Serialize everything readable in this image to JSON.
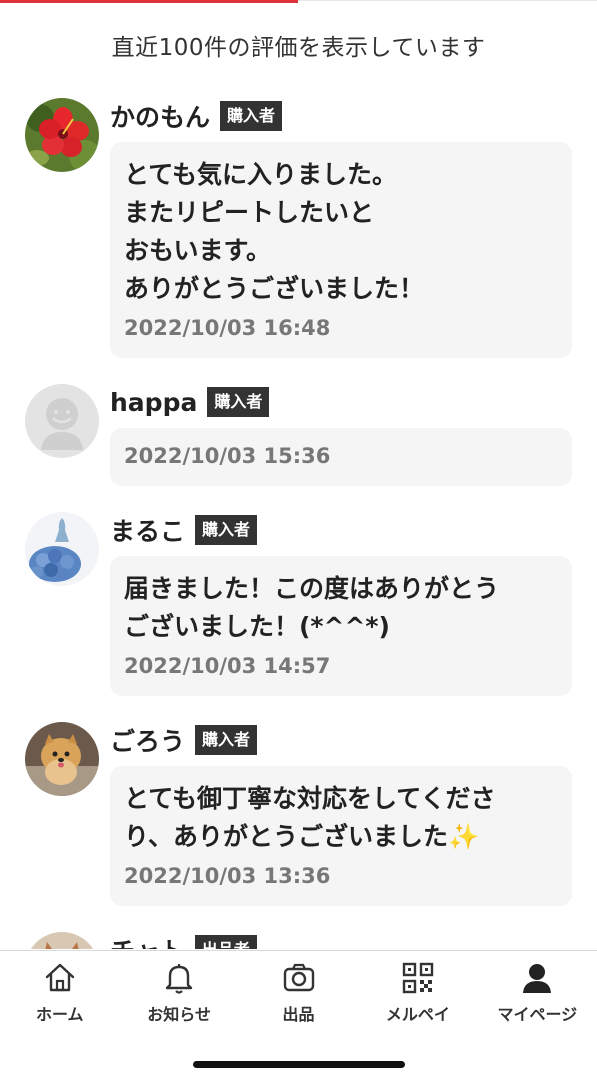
{
  "header": {
    "title": "直近100件の評価を表示しています"
  },
  "reviews": [
    {
      "name": "かのもん",
      "badge": "購入者",
      "comment": "とても気に入りました。\nまたリピートしたいと\nおもいます。\nありがとうございました！",
      "date": "2022/10/03 16:48",
      "avatar_icon": "hibiscus-photo-avatar"
    },
    {
      "name": "happa",
      "badge": "購入者",
      "comment": "",
      "date": "2022/10/03 15:36",
      "avatar_icon": "default-user-avatar"
    },
    {
      "name": "まるこ",
      "badge": "購入者",
      "comment": "届きました！この度はありがとう\nございました！(*^^*)",
      "date": "2022/10/03 14:57",
      "avatar_icon": "hydrangea-photo-avatar"
    },
    {
      "name": "ごろう",
      "badge": "購入者",
      "comment": "とても御丁寧な対応をしてくださ\nり、ありがとうございました✨",
      "date": "2022/10/03 13:36",
      "avatar_icon": "dog-photo-avatar"
    },
    {
      "name": "チャト",
      "badge": "出品者",
      "comment": "",
      "date": "",
      "avatar_icon": "cat-photo-avatar"
    }
  ],
  "tabbar": {
    "items": [
      {
        "label": "ホーム",
        "icon": "home-icon"
      },
      {
        "label": "お知らせ",
        "icon": "bell-icon"
      },
      {
        "label": "出品",
        "icon": "camera-icon"
      },
      {
        "label": "メルペイ",
        "icon": "qr-code-icon"
      },
      {
        "label": "マイページ",
        "icon": "person-icon"
      }
    ]
  },
  "colors": {
    "accent": "#e0323c",
    "badge_bg": "#333333",
    "bubble_bg": "#f5f5f5",
    "date_text": "#777777"
  }
}
